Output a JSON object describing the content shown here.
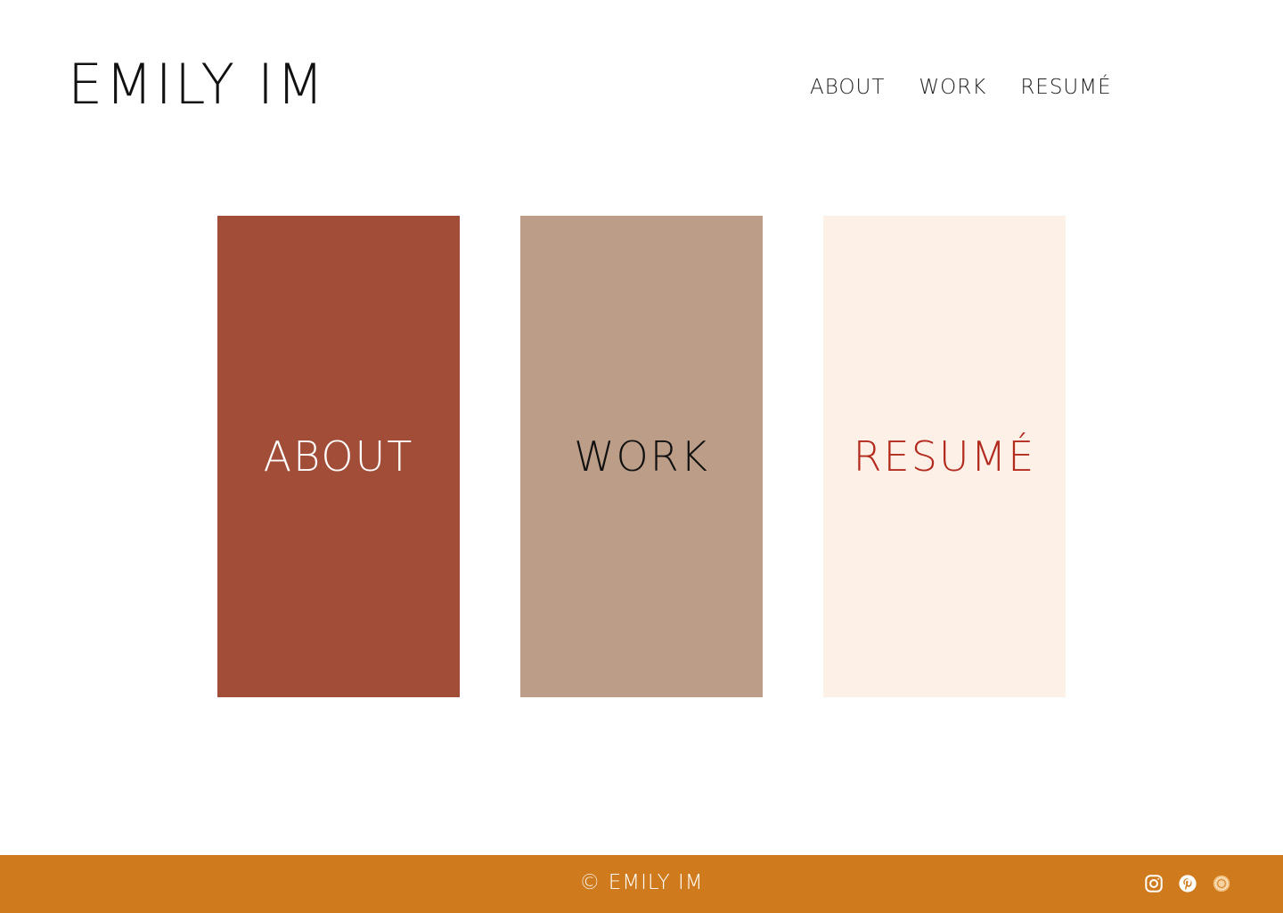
{
  "header": {
    "logo": "EMILY IM",
    "nav": [
      {
        "label": "ABOUT"
      },
      {
        "label": "WORK"
      },
      {
        "label": "RESUMÉ"
      }
    ]
  },
  "cards": [
    {
      "label": "ABOUT",
      "background": "#a14d38",
      "text_color": "#ffffff"
    },
    {
      "label": "WORK",
      "background": "#bc9e88",
      "text_color": "#111111"
    },
    {
      "label": "RESUMÉ",
      "background": "#fdf0e6",
      "text_color": "#b32a1e"
    }
  ],
  "footer": {
    "copyright": "© EMILY IM",
    "background": "#cf7a1c",
    "social": [
      {
        "icon": "instagram-icon"
      },
      {
        "icon": "pinterest-icon"
      },
      {
        "icon": "dribbble-icon"
      }
    ]
  }
}
